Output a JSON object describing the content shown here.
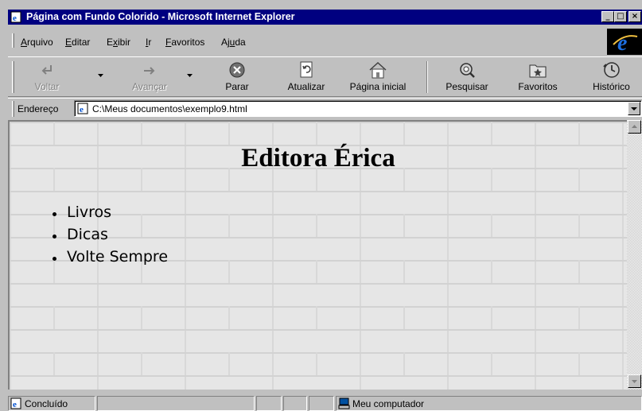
{
  "window": {
    "title": "Página com Fundo Colorido - Microsoft Internet Explorer",
    "controls": {
      "minimize": "_",
      "maximize": "□",
      "close": "×"
    }
  },
  "menu": {
    "items": [
      {
        "label": "Arquivo",
        "accel": "A",
        "rest": "rquivo"
      },
      {
        "label": "Editar",
        "accel": "E",
        "rest": "ditar"
      },
      {
        "label": "Exibir",
        "pre": "E",
        "accel": "x",
        "rest": "ibir"
      },
      {
        "label": "Ir",
        "accel": "I",
        "rest": "r"
      },
      {
        "label": "Favoritos",
        "accel": "F",
        "rest": "avoritos"
      },
      {
        "label": "Ajuda",
        "pre": "Aj",
        "accel": "u",
        "rest": "da"
      }
    ]
  },
  "toolbar": {
    "back": "Voltar",
    "forward": "Avançar",
    "stop": "Parar",
    "refresh": "Atualizar",
    "home": "Página inicial",
    "search": "Pesquisar",
    "favorites": "Favoritos",
    "history": "Histórico"
  },
  "address": {
    "label": "Endereço",
    "url": "C:\\Meus documentos\\exemplo9.html"
  },
  "page": {
    "heading": "Editora Érica",
    "list": [
      "Livros",
      "Dicas",
      "Volte Sempre"
    ]
  },
  "status": {
    "text": "Concluído",
    "zone": "Meu computador"
  },
  "colors": {
    "titlebar": "#000080",
    "chrome": "#c0c0c0"
  }
}
